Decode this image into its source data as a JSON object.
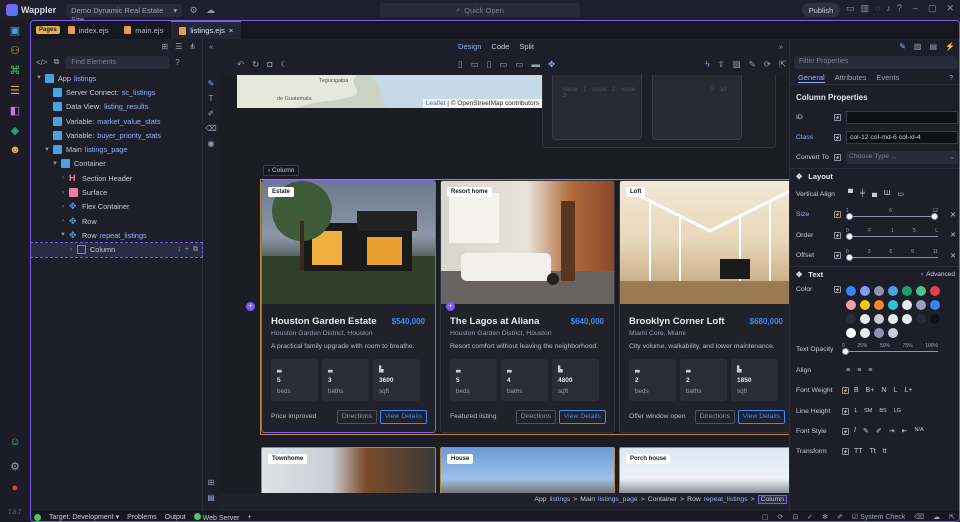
{
  "titlebar": {
    "app": "Wappler",
    "site": "Demo Dynamic Real Estate Site",
    "quick_open": "Quick Open",
    "publish": "Publish"
  },
  "version": "7.8.7",
  "tabs": {
    "pages_badge": "Pages",
    "files": [
      "index.ejs",
      "main.ejs",
      "listings.ejs"
    ],
    "close": "×"
  },
  "left": {
    "search_placeholder": "Find Elements",
    "tree": [
      {
        "label": "App",
        "value": "listings"
      },
      {
        "label": "Server Connect:",
        "value": "sc_listings"
      },
      {
        "label": "Data View:",
        "value": "listing_results"
      },
      {
        "label": "Variable:",
        "value": "market_value_stats"
      },
      {
        "label": "Variable:",
        "value": "buyer_priority_stats"
      },
      {
        "label": "Main",
        "value": "listings_page"
      },
      {
        "label": "Container",
        "value": ""
      },
      {
        "label": "Section Header",
        "value": ""
      },
      {
        "label": "Surface",
        "value": ""
      },
      {
        "label": "Flex Container",
        "value": ""
      },
      {
        "label": "Row",
        "value": ""
      },
      {
        "label": "Row",
        "value": "repeat_listings"
      },
      {
        "label": "Column",
        "value": ""
      }
    ]
  },
  "canvas": {
    "modes": [
      "Design",
      "Code",
      "Split"
    ],
    "column_chip": "Column",
    "leaflet": "Leaflet",
    "leaflet_attr": "| © OpenStreetMap contributors",
    "map_places": [
      "Tegucigalpa",
      "de Guatemala"
    ],
    "stat_boxes": [
      "value 1  value 2  value 3",
      "5    10"
    ],
    "cards": [
      {
        "badge": "Estate",
        "title": "Houston Garden Estate",
        "price": "$540,000",
        "location": "Houston Garden District, Houston",
        "desc": "A practical family upgrade with room to breathe.",
        "beds": "5",
        "baths": "3",
        "sqft": "3600",
        "note": "Price improved"
      },
      {
        "badge": "Resort home",
        "title": "The Lagos at Aliana",
        "price": "$640,000",
        "location": "Houston Garden District, Houston",
        "desc": "Resort comfort without leaving the neighborhood.",
        "beds": "5",
        "baths": "4",
        "sqft": "4800",
        "note": "Featured listing"
      },
      {
        "badge": "Loft",
        "title": "Brooklyn Corner Loft",
        "price": "$680,000",
        "location": "Miami Core, Miami",
        "desc": "City volume, walkability, and lower maintenance.",
        "beds": "2",
        "baths": "2",
        "sqft": "1850",
        "note": "Offer window open"
      }
    ],
    "stat_labels": {
      "beds": "beds",
      "baths": "baths",
      "sqft": "sqft"
    },
    "buttons": {
      "directions": "Directions",
      "view": "View Details"
    },
    "row2_badges": [
      "Townhome",
      "House",
      "Porch house"
    ],
    "breadcrumb": [
      {
        "label": "App",
        "value": "listings"
      },
      {
        "label": "Main",
        "value": "listings_page"
      },
      {
        "label": "Container",
        "value": ""
      },
      {
        "label": "Row",
        "value": "repeat_listings"
      }
    ],
    "breadcrumb_current": "Column",
    "sep": ">"
  },
  "right": {
    "filter_placeholder": "Filter Properties",
    "tabs": [
      "General",
      "Attributes",
      "Events"
    ],
    "section_title": "Column Properties",
    "id_label": "ID",
    "class_label": "Class",
    "class_value": "col-12 col-md-6 col-xl-4",
    "convert_label": "Convert To",
    "convert_placeholder": "Choose Type ...",
    "layout": "Layout",
    "vertical_align": "Vertical Align",
    "size": "Size",
    "order": "Order",
    "offset": "Offset",
    "size_ticks": [
      "1",
      "6",
      "12"
    ],
    "order_ticks": [
      "0",
      "F",
      "1",
      "5",
      "L"
    ],
    "offset_ticks": [
      "0",
      "3",
      "6",
      "9",
      "11"
    ],
    "text": "Text",
    "advanced": "Advanced",
    "color": "Color",
    "text_opacity": "Text Opacity",
    "opacity_ticks": [
      "0",
      "25%",
      "50%",
      "75%",
      "100%"
    ],
    "align": "Align",
    "font_weight": "Font Weight",
    "fw_options": [
      "B",
      "B+",
      "N",
      "L",
      "L+"
    ],
    "line_height": "Line Height",
    "lh_options": [
      "1",
      "SM",
      "BS",
      "LG"
    ],
    "font_style": "Font Style",
    "fs_na": "N/A",
    "transform": "Transform",
    "tf_options": [
      "TT",
      "Tt",
      "tt"
    ],
    "swatch_colors": [
      "#3b82f6",
      "#7c9ef7",
      "#8e93ad",
      "#4aa3e0",
      "#22a06b",
      "#4cc48a",
      "#e0414f",
      "#f0a0a8",
      "#f5c518",
      "#f08a2a",
      "#2ec4d6",
      "#e8eaf2",
      "#9aa0b8",
      "#3b82f6",
      "#2a2b38",
      "#e8eaf2",
      "#c9cbd8",
      "#e8eaf2",
      "#e8eaf2",
      "#2a2b38",
      "#0f1016",
      "#ffffff",
      "#e8eaf2",
      "#8e93ad",
      "#c9cbd8"
    ]
  },
  "bottom": {
    "target_label": "Target:",
    "target": "Development",
    "problems": "Problems",
    "output": "Output",
    "web_server": "Web Server",
    "system_check": "System Check"
  }
}
